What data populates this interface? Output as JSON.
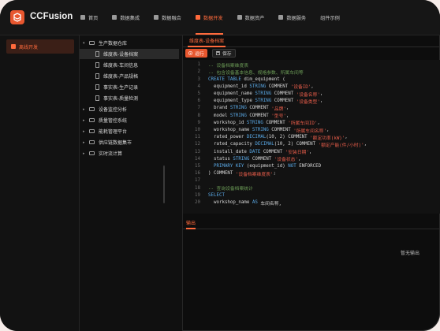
{
  "app": {
    "brand": "CCFusion"
  },
  "nav": {
    "items": [
      {
        "label": "首页",
        "icon": "home-icon"
      },
      {
        "label": "数据集成",
        "icon": "grid-icon"
      },
      {
        "label": "数据融合",
        "icon": "layers-icon"
      },
      {
        "label": "数据开发",
        "icon": "code-icon",
        "active": true
      },
      {
        "label": "数据资产",
        "icon": "database-icon"
      },
      {
        "label": "数据服务",
        "icon": "service-icon"
      },
      {
        "label": "组件示例",
        "icon": ""
      }
    ]
  },
  "sidebar": {
    "items": [
      {
        "label": "离线开发",
        "active": true
      }
    ]
  },
  "tree": {
    "rows": [
      {
        "label": "生产数据仓库",
        "type": "folder",
        "expanded": true,
        "depth": 0
      },
      {
        "label": "维度表-设备档案",
        "type": "file",
        "depth": 1,
        "selected": true
      },
      {
        "label": "维度表-车间信息",
        "type": "file",
        "depth": 1
      },
      {
        "label": "维度表-产品规格",
        "type": "file",
        "depth": 1
      },
      {
        "label": "事实表-生产记录",
        "type": "file",
        "depth": 1
      },
      {
        "label": "事实表-质量检测",
        "type": "file",
        "depth": 1
      },
      {
        "label": "设备监控分析",
        "type": "folder",
        "depth": 0
      },
      {
        "label": "质量管控系统",
        "type": "folder",
        "depth": 0
      },
      {
        "label": "能耗管理平台",
        "type": "folder",
        "depth": 0
      },
      {
        "label": "供应链数据集市",
        "type": "folder",
        "depth": 0
      },
      {
        "label": "实时流计算",
        "type": "folder",
        "depth": 0
      }
    ]
  },
  "editor": {
    "tab": "维度表-设备档案",
    "run_label": "运行",
    "save_label": "保存",
    "lines": [
      {
        "n": "1",
        "parts": [
          [
            "cm",
            "-- 设备档案维度表"
          ]
        ]
      },
      {
        "n": "2",
        "parts": [
          [
            "cm",
            "-- 包含设备基本信息、规格参数、所属车间等"
          ]
        ]
      },
      {
        "n": "3",
        "parts": [
          [
            "kw",
            "CREATE TABLE "
          ],
          [
            "code",
            "dim_equipment ("
          ]
        ]
      },
      {
        "n": "4",
        "parts": [
          [
            "code",
            "  equipment_id "
          ],
          [
            "kw",
            "STRING "
          ],
          [
            "code",
            "COMMENT "
          ],
          [
            "str",
            "'设备ID'"
          ],
          [
            "code",
            ","
          ]
        ]
      },
      {
        "n": "5",
        "parts": [
          [
            "code",
            "  equipment_name "
          ],
          [
            "kw",
            "STRING "
          ],
          [
            "code",
            "COMMENT "
          ],
          [
            "str",
            "'设备名称'"
          ],
          [
            "code",
            ","
          ]
        ]
      },
      {
        "n": "6",
        "parts": [
          [
            "code",
            "  equipment_type "
          ],
          [
            "kw",
            "STRING "
          ],
          [
            "code",
            "COMMENT "
          ],
          [
            "str",
            "'设备类型'"
          ],
          [
            "code",
            ","
          ]
        ]
      },
      {
        "n": "7",
        "parts": [
          [
            "code",
            "  brand "
          ],
          [
            "kw",
            "STRING "
          ],
          [
            "code",
            "COMMENT "
          ],
          [
            "str",
            "'品牌'"
          ],
          [
            "code",
            ","
          ]
        ]
      },
      {
        "n": "8",
        "parts": [
          [
            "code",
            "  model "
          ],
          [
            "kw",
            "STRING "
          ],
          [
            "code",
            "COMMENT "
          ],
          [
            "str",
            "'型号'"
          ],
          [
            "code",
            ","
          ]
        ]
      },
      {
        "n": "9",
        "parts": [
          [
            "code",
            "  workshop_id "
          ],
          [
            "kw",
            "STRING "
          ],
          [
            "code",
            "COMMENT "
          ],
          [
            "str",
            "'所属车间ID'"
          ],
          [
            "code",
            ","
          ]
        ]
      },
      {
        "n": "10",
        "parts": [
          [
            "code",
            "  workshop_name "
          ],
          [
            "kw",
            "STRING "
          ],
          [
            "code",
            "COMMENT "
          ],
          [
            "str",
            "'所属车间名称'"
          ],
          [
            "code",
            ","
          ]
        ]
      },
      {
        "n": "11",
        "parts": [
          [
            "code",
            "  rated_power "
          ],
          [
            "kw",
            "DECIMAL"
          ],
          [
            "code",
            "(10, 2) COMMENT "
          ],
          [
            "str",
            "'额定功率(kW)'"
          ],
          [
            "code",
            ","
          ]
        ]
      },
      {
        "n": "12",
        "parts": [
          [
            "code",
            "  rated_capacity "
          ],
          [
            "kw",
            "DECIMAL"
          ],
          [
            "code",
            "(10, 2) COMMENT "
          ],
          [
            "str",
            "'额定产能(件/小时)'"
          ],
          [
            "code",
            ","
          ]
        ]
      },
      {
        "n": "13",
        "parts": [
          [
            "code",
            "  install_date "
          ],
          [
            "kw",
            "DATE "
          ],
          [
            "code",
            "COMMENT "
          ],
          [
            "str",
            "'安装日期'"
          ],
          [
            "code",
            ","
          ]
        ]
      },
      {
        "n": "14",
        "parts": [
          [
            "code",
            "  status "
          ],
          [
            "kw",
            "STRING "
          ],
          [
            "code",
            "COMMENT "
          ],
          [
            "str",
            "'设备状态'"
          ],
          [
            "code",
            ","
          ]
        ]
      },
      {
        "n": "15",
        "parts": [
          [
            "code",
            "  "
          ],
          [
            "kw",
            "PRIMARY KEY "
          ],
          [
            "code",
            "(equipment_id) "
          ],
          [
            "kw",
            "NOT "
          ],
          [
            "code",
            "ENFORCED"
          ]
        ]
      },
      {
        "n": "16",
        "parts": [
          [
            "code",
            ") COMMENT "
          ],
          [
            "str",
            "'设备档案维度表'"
          ],
          [
            "code",
            ";"
          ]
        ]
      },
      {
        "n": "17",
        "parts": [
          [
            "code",
            ""
          ]
        ]
      },
      {
        "n": "18",
        "parts": [
          [
            "cm",
            "-- 查询设备档案统计"
          ]
        ]
      },
      {
        "n": "19",
        "parts": [
          [
            "kw",
            "SELECT"
          ]
        ]
      },
      {
        "n": "20",
        "parts": [
          [
            "code",
            "  workshop_name "
          ],
          [
            "kw",
            "AS "
          ],
          [
            "code",
            "车间名称,"
          ]
        ]
      }
    ]
  },
  "output": {
    "tab": "输出",
    "empty": "暂无输出"
  }
}
